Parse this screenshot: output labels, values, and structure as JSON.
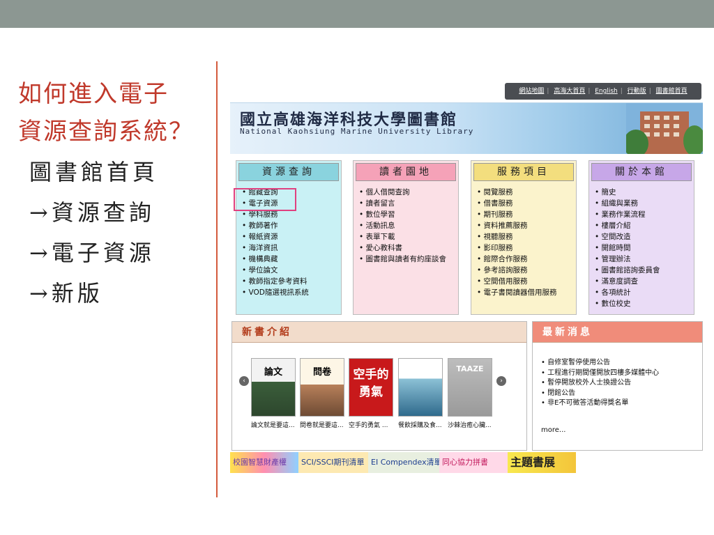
{
  "slide": {
    "title_lines": [
      "如何進入電子",
      "資源查詢系統？"
    ],
    "steps": [
      "圖書館首頁",
      "→資源查詢",
      "→電子資源",
      "→新版"
    ]
  },
  "library": {
    "top_links": [
      "網站地圖",
      "高海大首頁",
      "English",
      "行動版",
      "圖書館首頁"
    ],
    "name_zh": "國立高雄海洋科技大學圖書館",
    "name_en": "National Kaohsiung Marine University Library",
    "panels": [
      {
        "title": "資源查詢",
        "items": [
          "館藏查詢",
          "電子資源",
          "學科服務",
          "教師著作",
          "報紙資源",
          "海洋資訊",
          "機構典藏",
          "學位論文",
          "教師指定參考資料",
          "VOD隨選視訊系統"
        ]
      },
      {
        "title": "讀者園地",
        "items": [
          "個人借閱查詢",
          "讀者留言",
          "數位學習",
          "活動訊息",
          "表單下載",
          "愛心教科書",
          "圖書館與讀者有約座談會"
        ]
      },
      {
        "title": "服務項目",
        "items": [
          "閱覽服務",
          "借書服務",
          "期刊服務",
          "資料推薦服務",
          "視聽服務",
          "影印服務",
          "館際合作服務",
          "參考諮詢服務",
          "空間借用服務",
          "電子書閱讀器借用服務"
        ]
      },
      {
        "title": "關於本館",
        "items": [
          "簡史",
          "組織與業務",
          "業務作業流程",
          "樓層介紹",
          "空間改造",
          "開館時間",
          "管理辦法",
          "圖書館諮詢委員會",
          "滿意度調查",
          "各項統計",
          "數位校史"
        ]
      }
    ],
    "new_books": {
      "heading": "新書介紹",
      "books": [
        {
          "title": "論文就是要這...",
          "cover_text": "論文"
        },
        {
          "title": "問卷就是要這...",
          "cover_text": "問卷"
        },
        {
          "title": "空手的勇氣 ...",
          "cover_text": "空手的勇氣"
        },
        {
          "title": "餐飲採購及食...",
          "cover_text": ""
        },
        {
          "title": "沙棘治癒心臟...",
          "cover_text": "TAAZE"
        }
      ],
      "prev_symbol": "‹",
      "next_symbol": "›"
    },
    "news": {
      "heading": "最新消息",
      "items": [
        "自修室暫停使用公告",
        "工程進行期間僅開放四樓多媒體中心",
        "暫停開放校外人士換證公告",
        "閉館公告",
        "非E不可徵答活動得獎名單"
      ],
      "more": "more..."
    },
    "bottom_banners": [
      "校園智慧財產權",
      "SCI/SSCI期刊清單",
      "EI Compendex清單",
      "同心協力拼書",
      "主題書展"
    ]
  }
}
